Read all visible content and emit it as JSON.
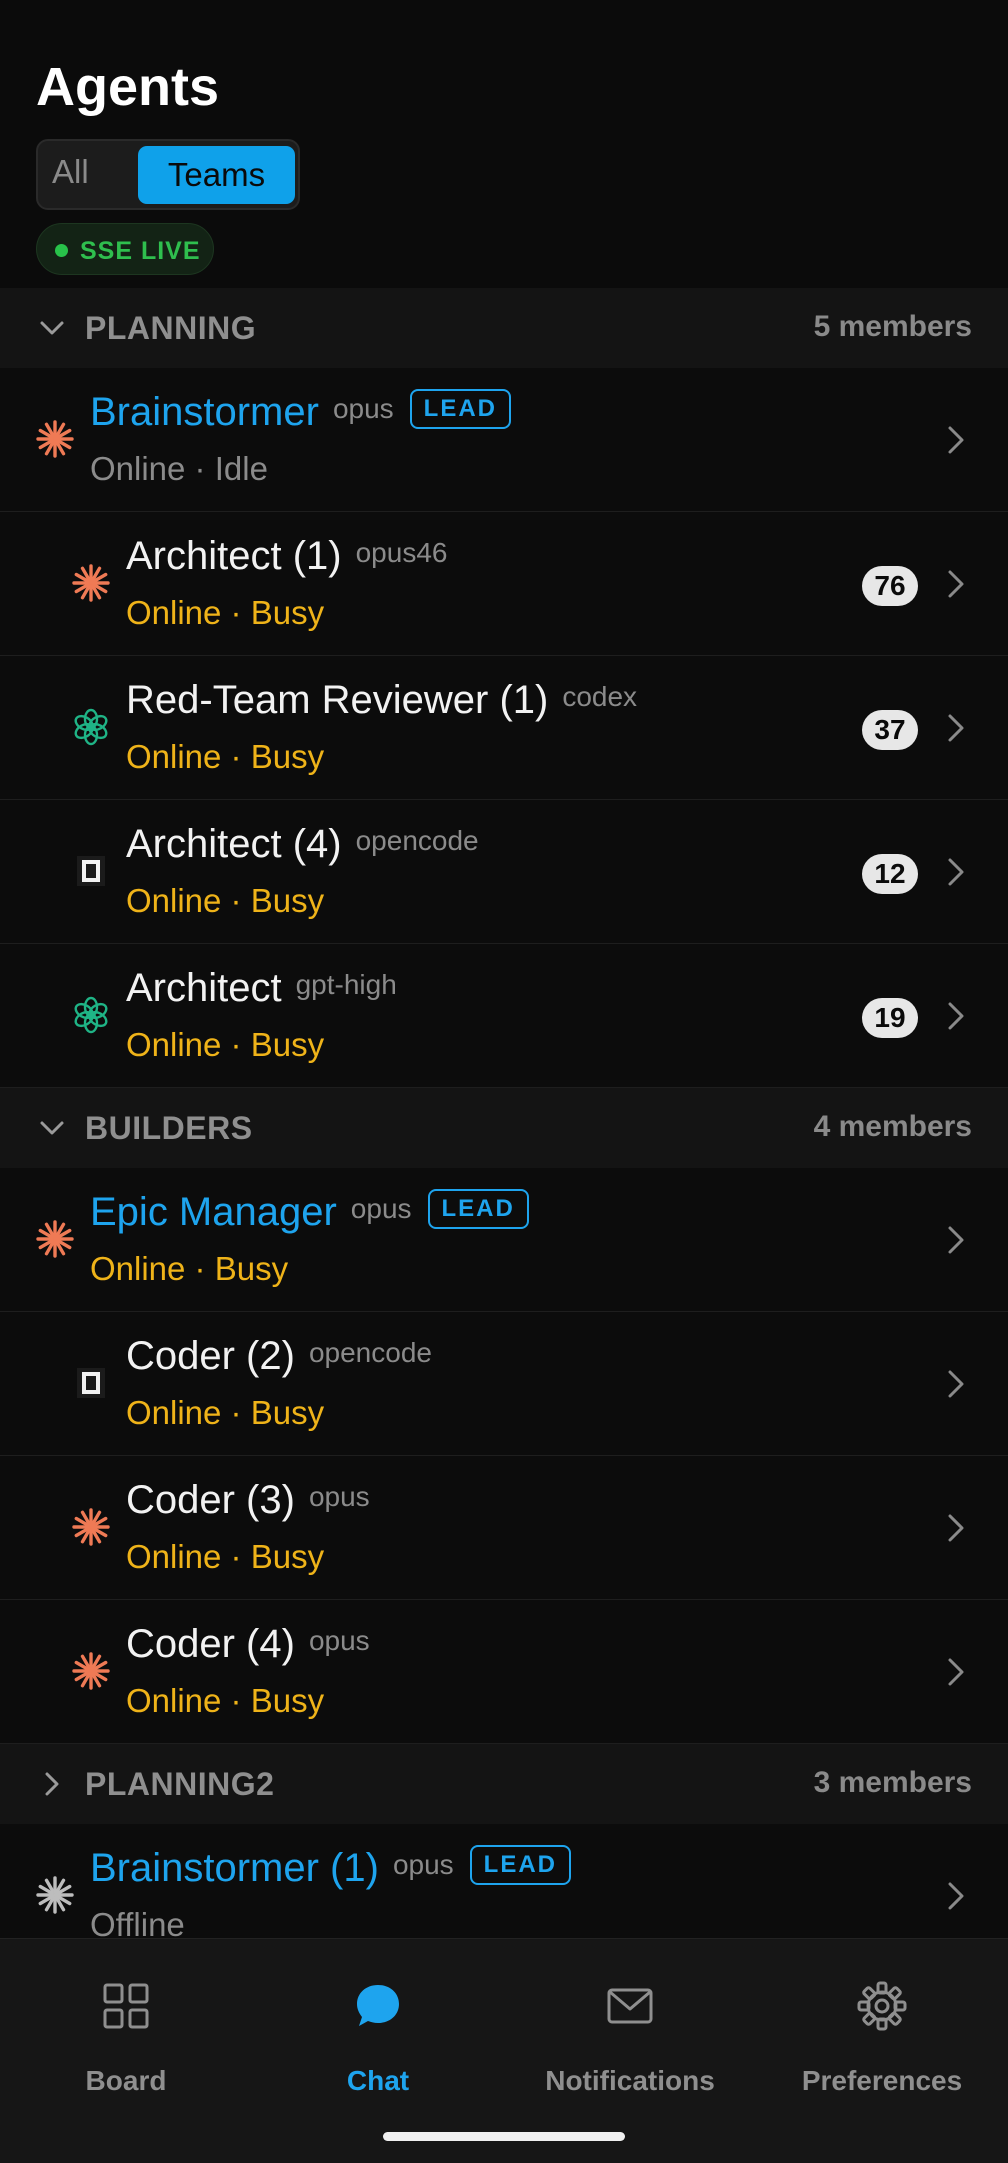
{
  "header": {
    "title": "Agents",
    "segments": {
      "all": "All",
      "teams": "Teams",
      "selected": "Teams"
    },
    "connection": {
      "label": "SSE LIVE",
      "color": "#2fbf4e"
    }
  },
  "colors": {
    "accent": "#1ea4ee",
    "busy": "#efb319",
    "idle": "#8b8b8b",
    "lead_badge": "#1ea4ee"
  },
  "groups": [
    {
      "name": "PLANNING",
      "member_count": "5 members",
      "expanded": true,
      "members": [
        {
          "name": "Brainstormer",
          "model": "opus",
          "badge": "LEAD",
          "is_lead": true,
          "status": "Online · Idle",
          "state": "idle",
          "icon": "anthropic-spark-icon",
          "count": null
        },
        {
          "name": "Architect (1)",
          "model": "opus46",
          "badge": null,
          "is_lead": false,
          "status": "Online · Busy",
          "state": "busy",
          "icon": "anthropic-spark-icon",
          "count": "76"
        },
        {
          "name": "Red-Team Reviewer (1)",
          "model": "codex",
          "badge": null,
          "is_lead": false,
          "status": "Online · Busy",
          "state": "busy",
          "icon": "openai-knot-icon",
          "count": "37"
        },
        {
          "name": "Architect (4)",
          "model": "opencode",
          "badge": null,
          "is_lead": false,
          "status": "Online · Busy",
          "state": "busy",
          "icon": "opencode-square-icon",
          "count": "12"
        },
        {
          "name": "Architect",
          "model": "gpt-high",
          "badge": null,
          "is_lead": false,
          "status": "Online · Busy",
          "state": "busy",
          "icon": "openai-knot-icon",
          "count": "19"
        }
      ]
    },
    {
      "name": "BUILDERS",
      "member_count": "4 members",
      "expanded": true,
      "members": [
        {
          "name": "Epic Manager",
          "model": "opus",
          "badge": "LEAD",
          "is_lead": true,
          "status": "Online · Busy",
          "state": "busy",
          "icon": "anthropic-spark-icon",
          "count": null
        },
        {
          "name": "Coder (2)",
          "model": "opencode",
          "badge": null,
          "is_lead": false,
          "status": "Online · Busy",
          "state": "busy",
          "icon": "opencode-square-icon",
          "count": null
        },
        {
          "name": "Coder (3)",
          "model": "opus",
          "badge": null,
          "is_lead": false,
          "status": "Online · Busy",
          "state": "busy",
          "icon": "anthropic-spark-icon",
          "count": null
        },
        {
          "name": "Coder (4)",
          "model": "opus",
          "badge": null,
          "is_lead": false,
          "status": "Online · Busy",
          "state": "busy",
          "icon": "anthropic-spark-icon",
          "count": null
        }
      ]
    },
    {
      "name": "PLANNING2",
      "member_count": "3 members",
      "expanded": false,
      "members": [
        {
          "name": "Brainstormer (1)",
          "model": "opus",
          "badge": "LEAD",
          "is_lead": true,
          "status": "Offline",
          "state": "offline",
          "icon": "anthropic-spark-icon",
          "count": null
        }
      ]
    }
  ],
  "tabbar": {
    "tabs": [
      {
        "label": "Board",
        "icon": "grid-icon",
        "active": false
      },
      {
        "label": "Chat",
        "icon": "chat-bubble-icon",
        "active": true
      },
      {
        "label": "Notifications",
        "icon": "envelope-icon",
        "active": false
      },
      {
        "label": "Preferences",
        "icon": "gear-icon",
        "active": false
      }
    ]
  }
}
